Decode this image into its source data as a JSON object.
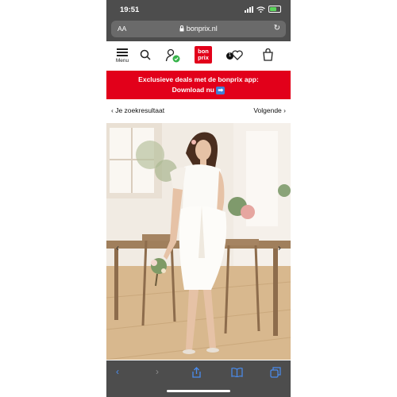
{
  "status_bar": {
    "time": "19:51"
  },
  "browser": {
    "text_size_label": "AA",
    "url": "bonprix.nl"
  },
  "site_nav": {
    "menu_label": "Menu",
    "logo_line1": "bon",
    "logo_line2": "prix",
    "wishlist_count": "1"
  },
  "promo": {
    "line1": "Exclusieve deals met de bonprix app:",
    "line2": "Download nu"
  },
  "result_nav": {
    "back_label": "Je zoekresultaat",
    "next_label": "Volgende"
  },
  "colors": {
    "brand_red": "#e2001a",
    "chrome_gray": "#4d4d4d",
    "link_blue": "#3f7fd6"
  },
  "icons": [
    "signal-icon",
    "wifi-icon",
    "battery-icon",
    "lock-icon",
    "reload-icon",
    "search-icon",
    "account-icon",
    "wishlist-icon",
    "cart-icon",
    "back-icon",
    "forward-icon",
    "share-icon",
    "bookmarks-icon",
    "tabs-icon"
  ]
}
